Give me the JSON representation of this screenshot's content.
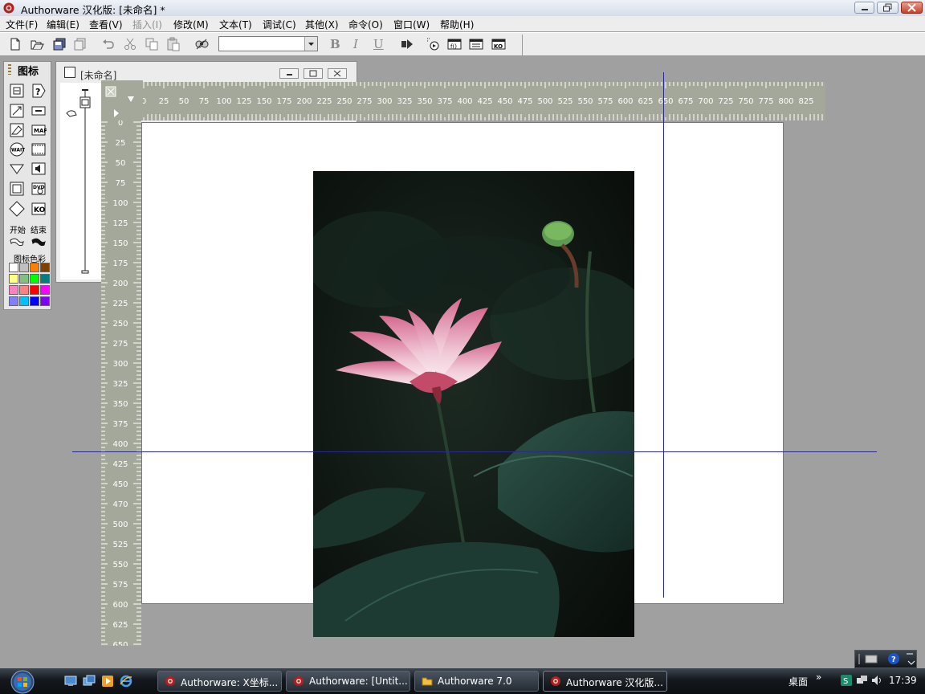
{
  "window": {
    "title": "Authorware 汉化版: [未命名] *"
  },
  "menu": [
    {
      "label": "文件(F)",
      "enabled": true
    },
    {
      "label": "编辑(E)",
      "enabled": true
    },
    {
      "label": "查看(V)",
      "enabled": true
    },
    {
      "label": "插入(I)",
      "enabled": false
    },
    {
      "label": "修改(M)",
      "enabled": true
    },
    {
      "label": "文本(T)",
      "enabled": true
    },
    {
      "label": "调试(C)",
      "enabled": true
    },
    {
      "label": "其他(X)",
      "enabled": true
    },
    {
      "label": "命令(O)",
      "enabled": true
    },
    {
      "label": "窗口(W)",
      "enabled": true
    },
    {
      "label": "帮助(H)",
      "enabled": true
    }
  ],
  "toolbar": {
    "font_value": "",
    "bold_label": "B",
    "italic_label": "I",
    "underline_label": "U"
  },
  "palette": {
    "title": "图标",
    "start_label": "开始",
    "end_label": "结束",
    "colors_label": "图标色彩",
    "swatches": [
      "#ffffff",
      "#c0c0c0",
      "#ff8000",
      "#804000",
      "#ffff80",
      "#80c080",
      "#00ff00",
      "#008080",
      "#ff80c0",
      "#ff8080",
      "#ff0000",
      "#ff00ff",
      "#8080ff",
      "#00c0ff",
      "#0000ff",
      "#8000ff"
    ]
  },
  "flowline": {
    "title": "[未命名]"
  },
  "ruler": {
    "top_ticks": [
      0,
      25,
      50,
      75,
      100,
      125,
      150,
      175,
      200,
      225,
      250,
      275,
      300,
      325,
      350,
      375,
      400,
      425,
      450,
      475,
      500,
      525,
      550,
      575,
      600,
      625,
      650,
      675,
      700,
      725,
      750,
      775,
      800,
      825
    ],
    "left_ticks": [
      0,
      25,
      50,
      75,
      100,
      125,
      150,
      175,
      200,
      225,
      250,
      275,
      300,
      325,
      350,
      375,
      400,
      425,
      450,
      470,
      500,
      525,
      550,
      575,
      600,
      625,
      650
    ]
  },
  "taskbar": {
    "tasks": [
      {
        "label": "Authorware: X坐标...",
        "active": false
      },
      {
        "label": "Authorware: [Untit...",
        "active": false
      },
      {
        "label": "Authorware 7.0",
        "active": false
      },
      {
        "label": "Authorware 汉化版...",
        "active": true
      }
    ],
    "desktop_label": "桌面",
    "chevron": "»",
    "clock": "17:39"
  }
}
